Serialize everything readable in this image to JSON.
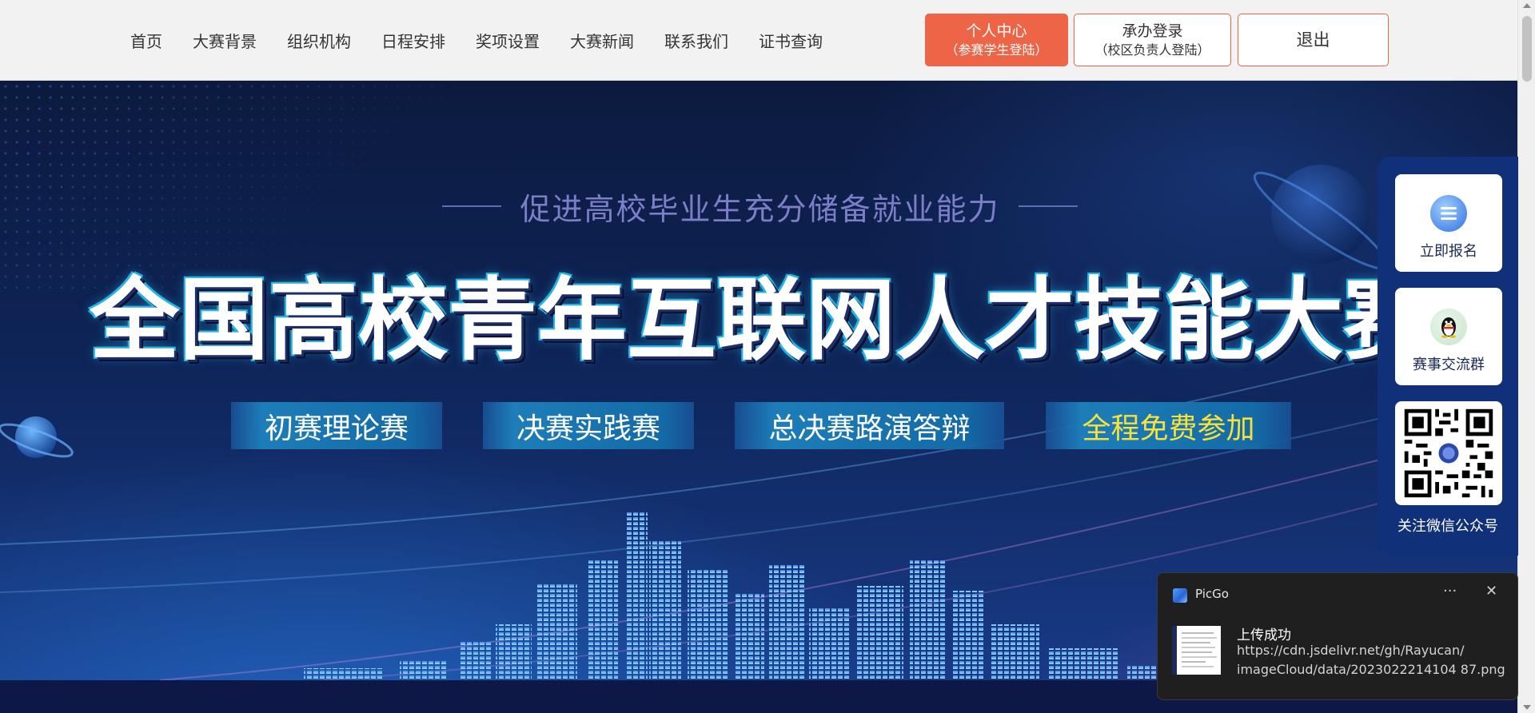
{
  "nav": {
    "items": [
      {
        "label": "首页"
      },
      {
        "label": "大赛背景"
      },
      {
        "label": "组织机构"
      },
      {
        "label": "日程安排"
      },
      {
        "label": "奖项设置"
      },
      {
        "label": "大赛新闻"
      },
      {
        "label": "联系我们"
      },
      {
        "label": "证书查询"
      }
    ]
  },
  "buttons": {
    "personal": {
      "line1": "个人中心",
      "line2": "（参赛学生登陆）"
    },
    "host": {
      "line1": "承办登录",
      "line2": "（校区负责人登陆）"
    },
    "logout": {
      "line1": "退出"
    }
  },
  "banner": {
    "subtitle": "促进高校毕业生充分储备就业能力",
    "title": "全国高校青年互联网人才技能大赛",
    "pills": [
      "初赛理论赛",
      "决赛实践赛",
      "总决赛路演答辩",
      "全程免费参加"
    ]
  },
  "float_panel": {
    "register": "立即报名",
    "group": "赛事交流群",
    "wechat": "关注微信公众号"
  },
  "toast": {
    "app": "PicGo",
    "more": "···",
    "close": "✕",
    "title": "上传成功",
    "url_line1": "https://cdn.jsdelivr.net/gh/Rayucan/",
    "url_line2": "imageCloud/data/2023022214104 87.png"
  },
  "icons": {
    "register": "register-list-icon",
    "group": "qq-penguin-icon",
    "qr": "wechat-qr-code"
  },
  "colors": {
    "accent": "#ee6446",
    "nav_text": "#333333",
    "banner_dark": "#0c1a3e",
    "pill_highlight_text": "#f7e23b",
    "float_panel_bg": "#11307a",
    "toast_bg": "#1f1f1f"
  }
}
